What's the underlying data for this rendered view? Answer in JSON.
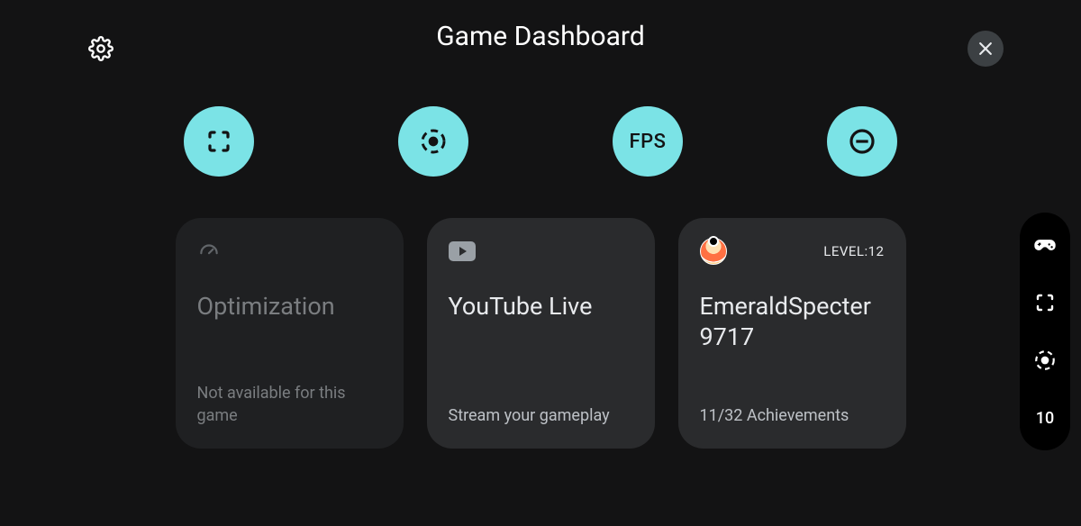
{
  "header": {
    "title": "Game Dashboard"
  },
  "actions": {
    "fps_label": "FPS"
  },
  "cards": {
    "optimization": {
      "title": "Optimization",
      "subtitle": "Not available for this game"
    },
    "youtube": {
      "title": "YouTube Live",
      "subtitle": "Stream your gameplay"
    },
    "profile": {
      "username": "EmeraldSpecter9717",
      "level_label": "LEVEL:12",
      "achievements": "11/32 Achievements"
    }
  },
  "floating": {
    "fps_value": "10"
  }
}
